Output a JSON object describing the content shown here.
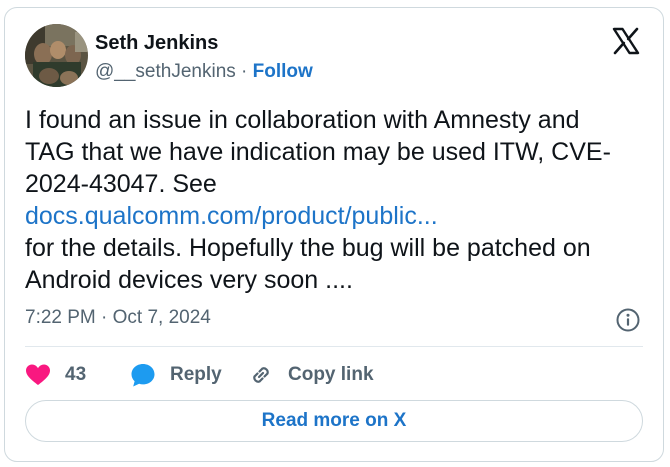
{
  "author": {
    "name": "Seth Jenkins",
    "handle": "@__sethJenkins",
    "separator": "·",
    "follow_label": "Follow"
  },
  "tweet": {
    "line1": "I found an issue in collaboration with Amnesty and",
    "line2": "TAG that we have indication may be used ITW, CVE-",
    "line3": "2024-43047. See",
    "link_text": "docs.qualcomm.com/product/public...",
    "line5": "for the details. Hopefully the bug will be patched on",
    "line6": "Android devices very soon ....",
    "timestamp": "7:22 PM · Oct 7, 2024"
  },
  "actions": {
    "like_count": "43",
    "reply_label": "Reply",
    "copy_link_label": "Copy link"
  },
  "footer": {
    "read_more_label": "Read more on X"
  },
  "colors": {
    "link": "#1d74c8",
    "like": "#f91880",
    "reply": "#1d9bf0",
    "text": "#0f1419",
    "muted": "#536471"
  },
  "icons": [
    "x-logo-icon",
    "info-icon",
    "heart-icon",
    "reply-bubble-icon",
    "link-icon"
  ]
}
